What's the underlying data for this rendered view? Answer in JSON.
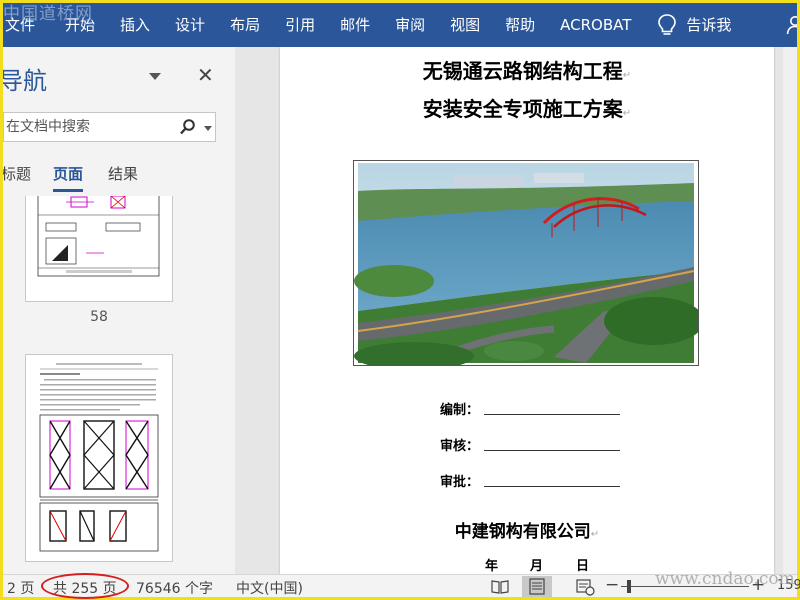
{
  "watermarks": {
    "top": "中国道桥网",
    "bottom": "www.cndao.com"
  },
  "ribbon": {
    "items": [
      "文件",
      "开始",
      "插入",
      "设计",
      "布局",
      "引用",
      "邮件",
      "审阅",
      "视图",
      "帮助",
      "ACROBAT"
    ],
    "tell_me": "告诉我",
    "share": "共"
  },
  "nav": {
    "title": "导航",
    "search_placeholder": "在文档中搜索",
    "tabs": [
      "标题",
      "页面",
      "结果"
    ],
    "page_number": "58"
  },
  "document": {
    "title_line1": "无锡通云路钢结构工程",
    "title_line2": "安装安全专项施工方案",
    "para_mark": "↵",
    "sign_labels": [
      "编制：",
      "审核：",
      "审批："
    ],
    "company": "中建钢构有限公司",
    "date_labels": [
      "年",
      "月",
      "日"
    ]
  },
  "status": {
    "page": "2 页",
    "total": "共 255 页",
    "words": "76546 个字",
    "language": "中文(中国)",
    "zoom": "159"
  },
  "colors": {
    "ribbon": "#2b579a",
    "highlight": "#d61e1e",
    "frame": "#f2de1d"
  }
}
